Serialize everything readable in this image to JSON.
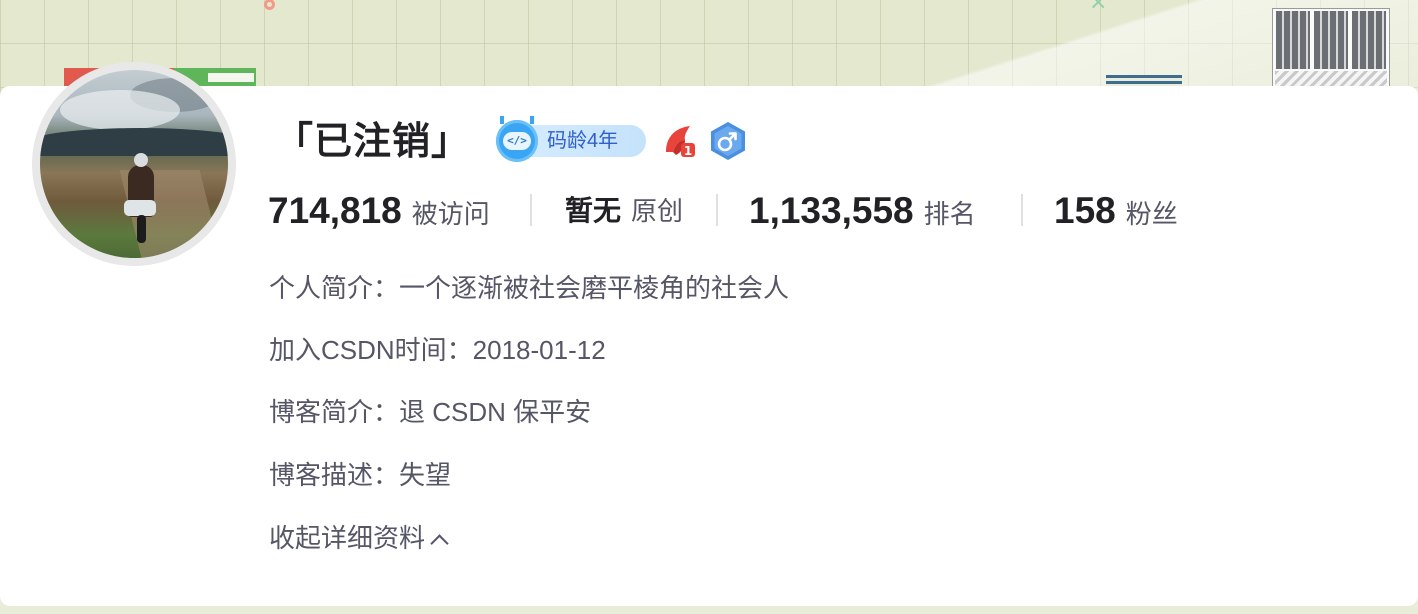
{
  "profile": {
    "name": "「已注销」",
    "badges": {
      "coding_age": "码龄4年",
      "blogger_icon": "blogger-level-1-icon",
      "gender_icon": "male-icon"
    }
  },
  "stats": [
    {
      "value": "714,818",
      "label": "被访问"
    },
    {
      "value": "暂无",
      "label": "原创"
    },
    {
      "value": "1,133,558",
      "label": "排名"
    },
    {
      "value": "158",
      "label": "粉丝"
    }
  ],
  "details": {
    "intro": "个人简介：一个逐渐被社会磨平棱角的社会人",
    "joined": "加入CSDN时间：2018-01-12",
    "blog_intro": "博客简介：退 CSDN 保平安",
    "blog_desc": "博客描述：失望",
    "collapse_label": "收起详细资料"
  },
  "colors": {
    "text_main": "#222226",
    "text_secondary": "#555666",
    "badge_blue": "#3ba5f5",
    "badge_red": "#e8443b"
  }
}
